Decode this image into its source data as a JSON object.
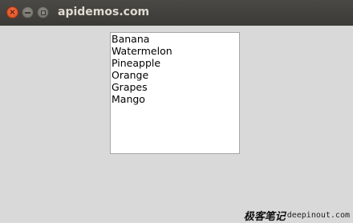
{
  "window": {
    "title": "apidemos.com",
    "close_glyph": "×"
  },
  "listbox": {
    "items": [
      "Banana",
      "Watermelon",
      "Pineapple",
      "Orange",
      "Grapes",
      "Mango"
    ]
  },
  "watermark": {
    "cjk": "极客笔记",
    "domain": "deepinout.com"
  }
}
